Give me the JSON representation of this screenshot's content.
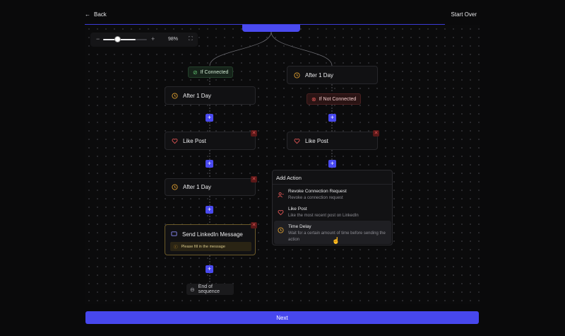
{
  "header": {
    "back_label": "Back",
    "start_over_label": "Start Over"
  },
  "zoom": {
    "level_label": "98%",
    "level": 0.98
  },
  "flow": {
    "left_branch": {
      "condition_label": "If Connected",
      "steps": [
        {
          "label": "After 1 Day",
          "icon": "clock-icon"
        },
        {
          "label": "Like Post",
          "icon": "heart-icon"
        },
        {
          "label": "After 1 Day",
          "icon": "clock-icon"
        },
        {
          "label": "Send LinkedIn Message",
          "icon": "message-icon",
          "warning": "Please fill in the message"
        }
      ],
      "end_label": "End of sequence"
    },
    "right_branch": {
      "steps": [
        {
          "label": "After 1 Day",
          "icon": "clock-icon"
        },
        {
          "label": "Like Post",
          "icon": "heart-icon"
        }
      ],
      "condition_label": "If Not Connected"
    }
  },
  "add_action_menu": {
    "title": "Add Action",
    "items": [
      {
        "title": "Revoke Connection Request",
        "desc": "Revoke a connection request",
        "icon": "user-remove-icon"
      },
      {
        "title": "Like Post",
        "desc": "Like the most recent post on LinkedIn",
        "icon": "heart-icon"
      },
      {
        "title": "Time Delay",
        "desc": "Wait for a certain amount of time before sending the action",
        "icon": "clock-icon"
      }
    ]
  },
  "footer": {
    "next_label": "Next"
  },
  "colors": {
    "accent": "#4a4af0",
    "warning": "#e0a030",
    "danger": "#e05555",
    "success": "#5fbf6f"
  }
}
